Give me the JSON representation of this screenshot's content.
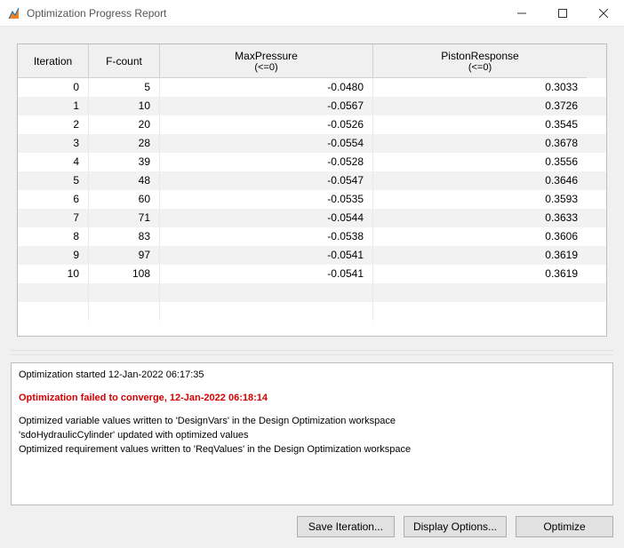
{
  "window": {
    "title": "Optimization Progress Report"
  },
  "table": {
    "headers": {
      "iteration": "Iteration",
      "fcount": "F-count",
      "maxpressure": "MaxPressure",
      "maxpressure_sub": "(<=0)",
      "piston": "PistonResponse",
      "piston_sub": "(<=0)"
    },
    "rows": [
      {
        "iteration": "0",
        "fcount": "5",
        "maxpressure": "-0.0480",
        "piston": "0.3033"
      },
      {
        "iteration": "1",
        "fcount": "10",
        "maxpressure": "-0.0567",
        "piston": "0.3726"
      },
      {
        "iteration": "2",
        "fcount": "20",
        "maxpressure": "-0.0526",
        "piston": "0.3545"
      },
      {
        "iteration": "3",
        "fcount": "28",
        "maxpressure": "-0.0554",
        "piston": "0.3678"
      },
      {
        "iteration": "4",
        "fcount": "39",
        "maxpressure": "-0.0528",
        "piston": "0.3556"
      },
      {
        "iteration": "5",
        "fcount": "48",
        "maxpressure": "-0.0547",
        "piston": "0.3646"
      },
      {
        "iteration": "6",
        "fcount": "60",
        "maxpressure": "-0.0535",
        "piston": "0.3593"
      },
      {
        "iteration": "7",
        "fcount": "71",
        "maxpressure": "-0.0544",
        "piston": "0.3633"
      },
      {
        "iteration": "8",
        "fcount": "83",
        "maxpressure": "-0.0538",
        "piston": "0.3606"
      },
      {
        "iteration": "9",
        "fcount": "97",
        "maxpressure": "-0.0541",
        "piston": "0.3619"
      },
      {
        "iteration": "10",
        "fcount": "108",
        "maxpressure": "-0.0541",
        "piston": "0.3619"
      }
    ]
  },
  "log": {
    "lines": [
      {
        "text": "Optimization started 12-Jan-2022 06:17:35",
        "error": false
      },
      {
        "text": "",
        "error": false
      },
      {
        "text": "Optimization failed to converge, 12-Jan-2022 06:18:14",
        "error": true
      },
      {
        "text": "",
        "error": false
      },
      {
        "text": "Optimized variable values written to 'DesignVars' in the Design Optimization workspace",
        "error": false
      },
      {
        "text": "'sdoHydraulicCylinder' updated with optimized values",
        "error": false
      },
      {
        "text": "Optimized requirement values written to 'ReqValues' in the Design Optimization workspace",
        "error": false
      }
    ]
  },
  "buttons": {
    "save_iteration": "Save Iteration...",
    "display_options": "Display Options...",
    "optimize": "Optimize"
  }
}
